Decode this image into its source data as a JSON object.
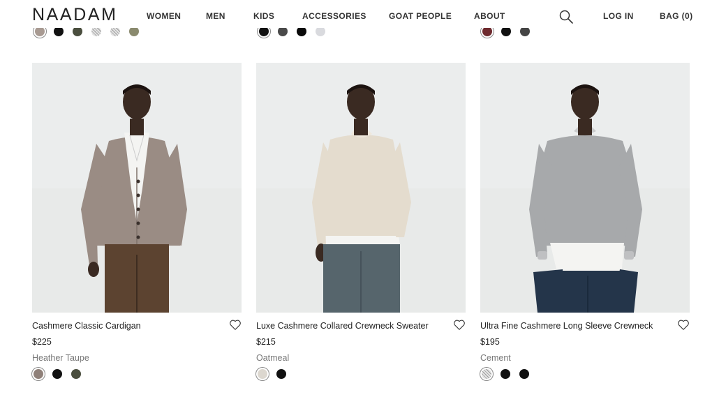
{
  "brand": {
    "logo": "NAADAM"
  },
  "nav": {
    "items": [
      "WOMEN",
      "MEN",
      "KIDS",
      "ACCESSORIES",
      "GOAT PEOPLE",
      "ABOUT"
    ],
    "login": "LOG IN",
    "bag": "BAG (0)"
  },
  "top_swatches": [
    [
      {
        "color": "#a89a92",
        "selected": true
      },
      {
        "color": "#111111"
      },
      {
        "color": "#4a4e3e"
      },
      {
        "color": "#6b7a8e",
        "pattern": "striped"
      },
      {
        "color": "#d0d0d0",
        "pattern": "striped"
      },
      {
        "color": "#8a8a6e"
      }
    ],
    [
      {
        "color": "#111111",
        "selected": true
      },
      {
        "color": "#4a4a4a"
      },
      {
        "color": "#0a0a0a"
      },
      {
        "color": "#d9dade"
      }
    ],
    [
      {
        "color": "#6e2a2e",
        "selected": true
      },
      {
        "color": "#111111"
      },
      {
        "color": "#454545"
      }
    ]
  ],
  "products": [
    {
      "name": "Cashmere Classic Cardigan",
      "price": "$225",
      "color_name": "Heather Taupe",
      "swatches": [
        {
          "color": "#8f8079",
          "selected": true
        },
        {
          "color": "#111111"
        },
        {
          "color": "#4a4e3e"
        }
      ],
      "garment_color": "#9a8c84",
      "pants_color": "#5c4330"
    },
    {
      "name": "Luxe Cashmere Collared Crewneck Sweater",
      "price": "$215",
      "color_name": "Oatmeal",
      "swatches": [
        {
          "color": "#dcd7cf",
          "selected": true
        },
        {
          "color": "#111111"
        }
      ],
      "garment_color": "#e4dcce",
      "pants_color": "#56656c"
    },
    {
      "name": "Ultra Fine Cashmere Long Sleeve Crewneck",
      "price": "$195",
      "color_name": "Cement",
      "swatches": [
        {
          "color": "#b5b5b5",
          "selected": true,
          "pattern": "striped"
        },
        {
          "color": "#111111"
        },
        {
          "color": "#111111"
        }
      ],
      "garment_color": "#a7a9ab",
      "pants_color": "#24354a"
    }
  ]
}
